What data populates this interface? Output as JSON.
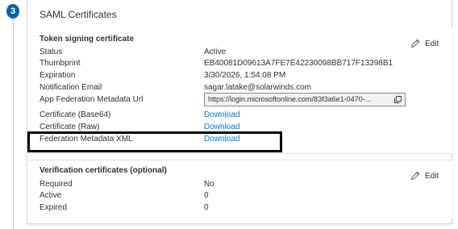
{
  "step": {
    "number": "3"
  },
  "card": {
    "title": "SAML Certificates"
  },
  "token_signing": {
    "title": "Token signing certificate",
    "edit_label": "Edit",
    "rows": [
      {
        "label": "Status",
        "value": "Active"
      },
      {
        "label": "Thumbprint",
        "value": "EB40081D09613A7FE7E42230098BB717F13398B1"
      },
      {
        "label": "Expiration",
        "value": "3/30/2026, 1:54:08 PM"
      },
      {
        "label": "Notification Email",
        "value": "sagar.latake@solarwinds.com"
      },
      {
        "label": "App Federation Metadata Url",
        "value": "https://login.microsoftonline.com/83f3a6e1-0470-..."
      },
      {
        "label": "Certificate (Base64)",
        "value": "Download"
      },
      {
        "label": "Certificate (Raw)",
        "value": "Download"
      },
      {
        "label": "Federation Metadata XML",
        "value": "Download"
      }
    ]
  },
  "verification": {
    "title": "Verification certificates (optional)",
    "edit_label": "Edit",
    "rows": [
      {
        "label": "Required",
        "value": "No"
      },
      {
        "label": "Active",
        "value": "0"
      },
      {
        "label": "Expired",
        "value": "0"
      }
    ]
  },
  "icons": {
    "edit": "pencil-icon",
    "copy": "copy-icon"
  },
  "colors": {
    "accent": "#0078d4",
    "badge": "#0063b1",
    "highlight": "#000000"
  }
}
